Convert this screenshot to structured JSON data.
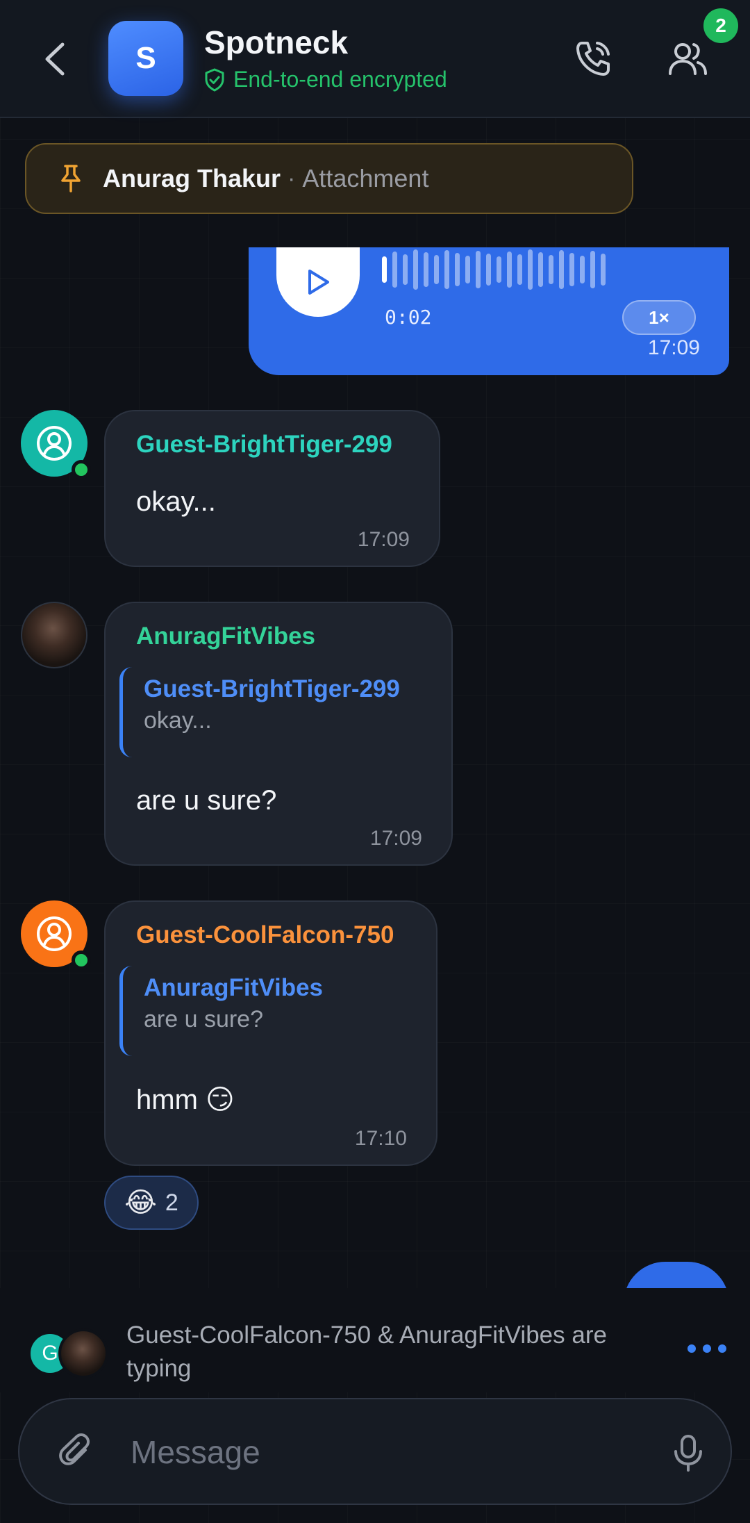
{
  "header": {
    "avatar_letter": "S",
    "title": "Spotneck",
    "encryption": "End-to-end encrypted",
    "members_badge": "2"
  },
  "pinned": {
    "name": "Anurag Thakur",
    "separator": "·",
    "kind": "Attachment"
  },
  "voice_message": {
    "duration": "0:02",
    "speed": "1×",
    "time": "17:09",
    "progress": 0.02
  },
  "messages": [
    {
      "sender": "Guest-BrightTiger-299",
      "text": "okay...",
      "time": "17:09"
    },
    {
      "sender": "AnuragFitVibes",
      "reply_to": {
        "sender": "Guest-BrightTiger-299",
        "text": "okay..."
      },
      "text": "are u sure?",
      "time": "17:09"
    },
    {
      "sender": "Guest-CoolFalcon-750",
      "reply_to": {
        "sender": "AnuragFitVibes",
        "text": "are u sure?"
      },
      "text": "hmm 😏",
      "time": "17:10",
      "reaction": {
        "emoji": "😂",
        "count": "2"
      }
    }
  ],
  "typing": {
    "avatar_letter": "G",
    "text": "Guest-CoolFalcon-750 & AnuragFitVibes are typing"
  },
  "composer": {
    "placeholder": "Message"
  },
  "colors": {
    "accent": "#2f6be8",
    "encrypted": "#25c26b",
    "sender_teal": "#2dd4bf",
    "sender_green": "#34d399",
    "sender_orange": "#fb923c",
    "pinned_icon": "#f0a332"
  },
  "icons": [
    "chevron-left-icon",
    "shield-check-icon",
    "phone-call-icon",
    "users-icon",
    "pin-icon",
    "play-icon",
    "user-circle-icon",
    "paperclip-icon",
    "microphone-icon"
  ]
}
